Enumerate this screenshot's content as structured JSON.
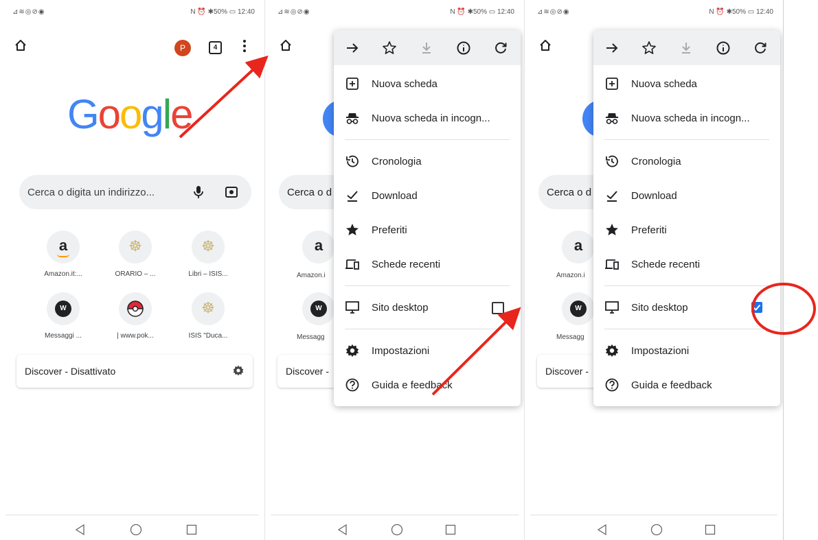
{
  "statusbar": {
    "left": "⊿≋◎⊘◉",
    "right": "N ⏰ ✱50% ▭ 12:40"
  },
  "colors": {
    "accent_red": "#e8261d",
    "check_blue": "#1a73e8",
    "avatar": "#d2461e",
    "google_blue": "#4285F4",
    "google_red": "#EA4335",
    "google_yellow": "#FBBC05",
    "google_green": "#34A853"
  },
  "screen1": {
    "avatar_letter": "P",
    "tab_count": "4",
    "logo": [
      "G",
      "o",
      "o",
      "g",
      "l",
      "e"
    ],
    "search_placeholder": "Cerca o digita un indirizzo...",
    "shortcuts": [
      {
        "label": "Amazon.it:...",
        "icon": "amazon-icon",
        "glyph": "a"
      },
      {
        "label": "ORARIO – ...",
        "icon": "wheel-emblem-icon",
        "glyph": "☸"
      },
      {
        "label": "Libri – ISIS...",
        "icon": "wheel-emblem-icon",
        "glyph": "☸"
      },
      {
        "label": "Messaggi ...",
        "icon": "w-icon",
        "glyph": "W"
      },
      {
        "label": "| www.pok...",
        "icon": "pokeball-icon",
        "glyph": ""
      },
      {
        "label": "ISIS \"Duca...",
        "icon": "wheel-emblem-icon",
        "glyph": "☸"
      }
    ],
    "discover_label": "Discover - Disattivato"
  },
  "fragments": {
    "search_text": "Cerca o d",
    "tile_label_1": "Amazon.i",
    "tile_label_2": "Messagg",
    "discover_text": "Discover -"
  },
  "menu": {
    "toolbar_icons": [
      "forward-icon",
      "star-icon",
      "download-icon",
      "info-icon",
      "reload-icon"
    ],
    "items": [
      {
        "label": "Nuova scheda",
        "icon": "new-tab-icon"
      },
      {
        "label": "Nuova scheda in incogn...",
        "icon": "incognito-icon"
      },
      {
        "label": "Cronologia",
        "icon": "history-icon"
      },
      {
        "label": "Download",
        "icon": "download-done-icon"
      },
      {
        "label": "Preferiti",
        "icon": "bookmark-star-icon"
      },
      {
        "label": "Schede recenti",
        "icon": "devices-icon"
      },
      {
        "label": "Sito desktop",
        "icon": "desktop-icon"
      },
      {
        "label": "Impostazioni",
        "icon": "settings-icon"
      },
      {
        "label": "Guida e feedback",
        "icon": "help-icon"
      }
    ]
  },
  "screen2": {
    "desktop_site_checked": false
  },
  "screen3": {
    "desktop_site_checked": true
  },
  "navbar_icons": [
    "back-icon",
    "home-circle-icon",
    "recents-icon"
  ]
}
